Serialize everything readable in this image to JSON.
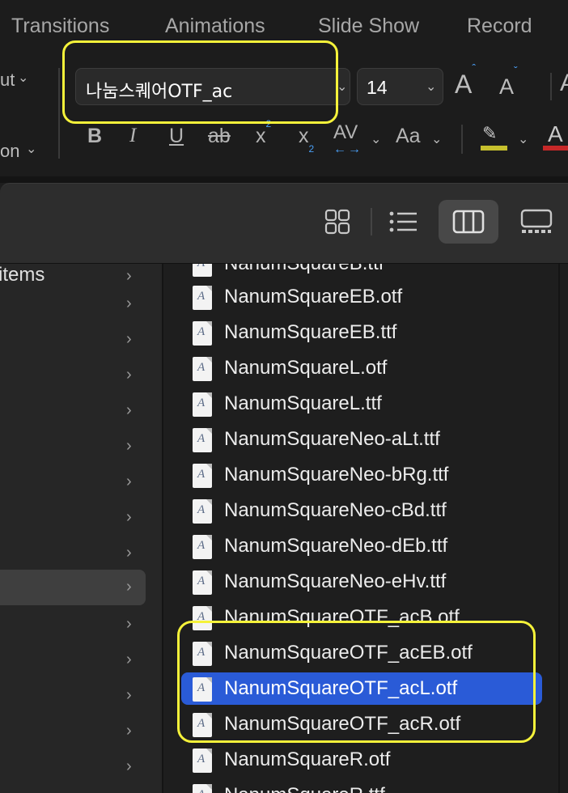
{
  "ribbon": {
    "tabs": [
      "Transitions",
      "Animations",
      "Slide Show",
      "Record"
    ],
    "left_labels": [
      "ut",
      "on"
    ],
    "font_name": "나눔스퀘어OTF_ac",
    "font_size": "14",
    "format_buttons": {
      "bold": "B",
      "italic": "I",
      "underline": "U",
      "strike": "ab",
      "superscript": "x",
      "subscript": "x",
      "spacing": "AV",
      "change_case": "Aa"
    },
    "grow_font": "A",
    "shrink_font": "A",
    "font_color": "A",
    "colors": {
      "highlight": "#c6c02d",
      "font_color": "#c62828",
      "accent": "#4a9ff5"
    }
  },
  "finder": {
    "view_modes": [
      "icon-view",
      "list-view",
      "column-view",
      "gallery-view"
    ],
    "active_view": "column-view",
    "sidebar_partial_label": "items",
    "selected_sidebar_index": 9,
    "files": [
      "NanumSquareB.ttf",
      "NanumSquareEB.otf",
      "NanumSquareEB.ttf",
      "NanumSquareL.otf",
      "NanumSquareL.ttf",
      "NanumSquareNeo-aLt.ttf",
      "NanumSquareNeo-bRg.ttf",
      "NanumSquareNeo-cBd.ttf",
      "NanumSquareNeo-dEb.ttf",
      "NanumSquareNeo-eHv.ttf",
      "NanumSquareOTF_acB.otf",
      "NanumSquareOTF_acEB.otf",
      "NanumSquareOTF_acL.otf",
      "NanumSquareOTF_acR.otf",
      "NanumSquareR.otf",
      "NanumSquareR.ttf"
    ],
    "selected_file": "NanumSquareOTF_acL.otf",
    "selection_color": "#2a5bd7"
  }
}
